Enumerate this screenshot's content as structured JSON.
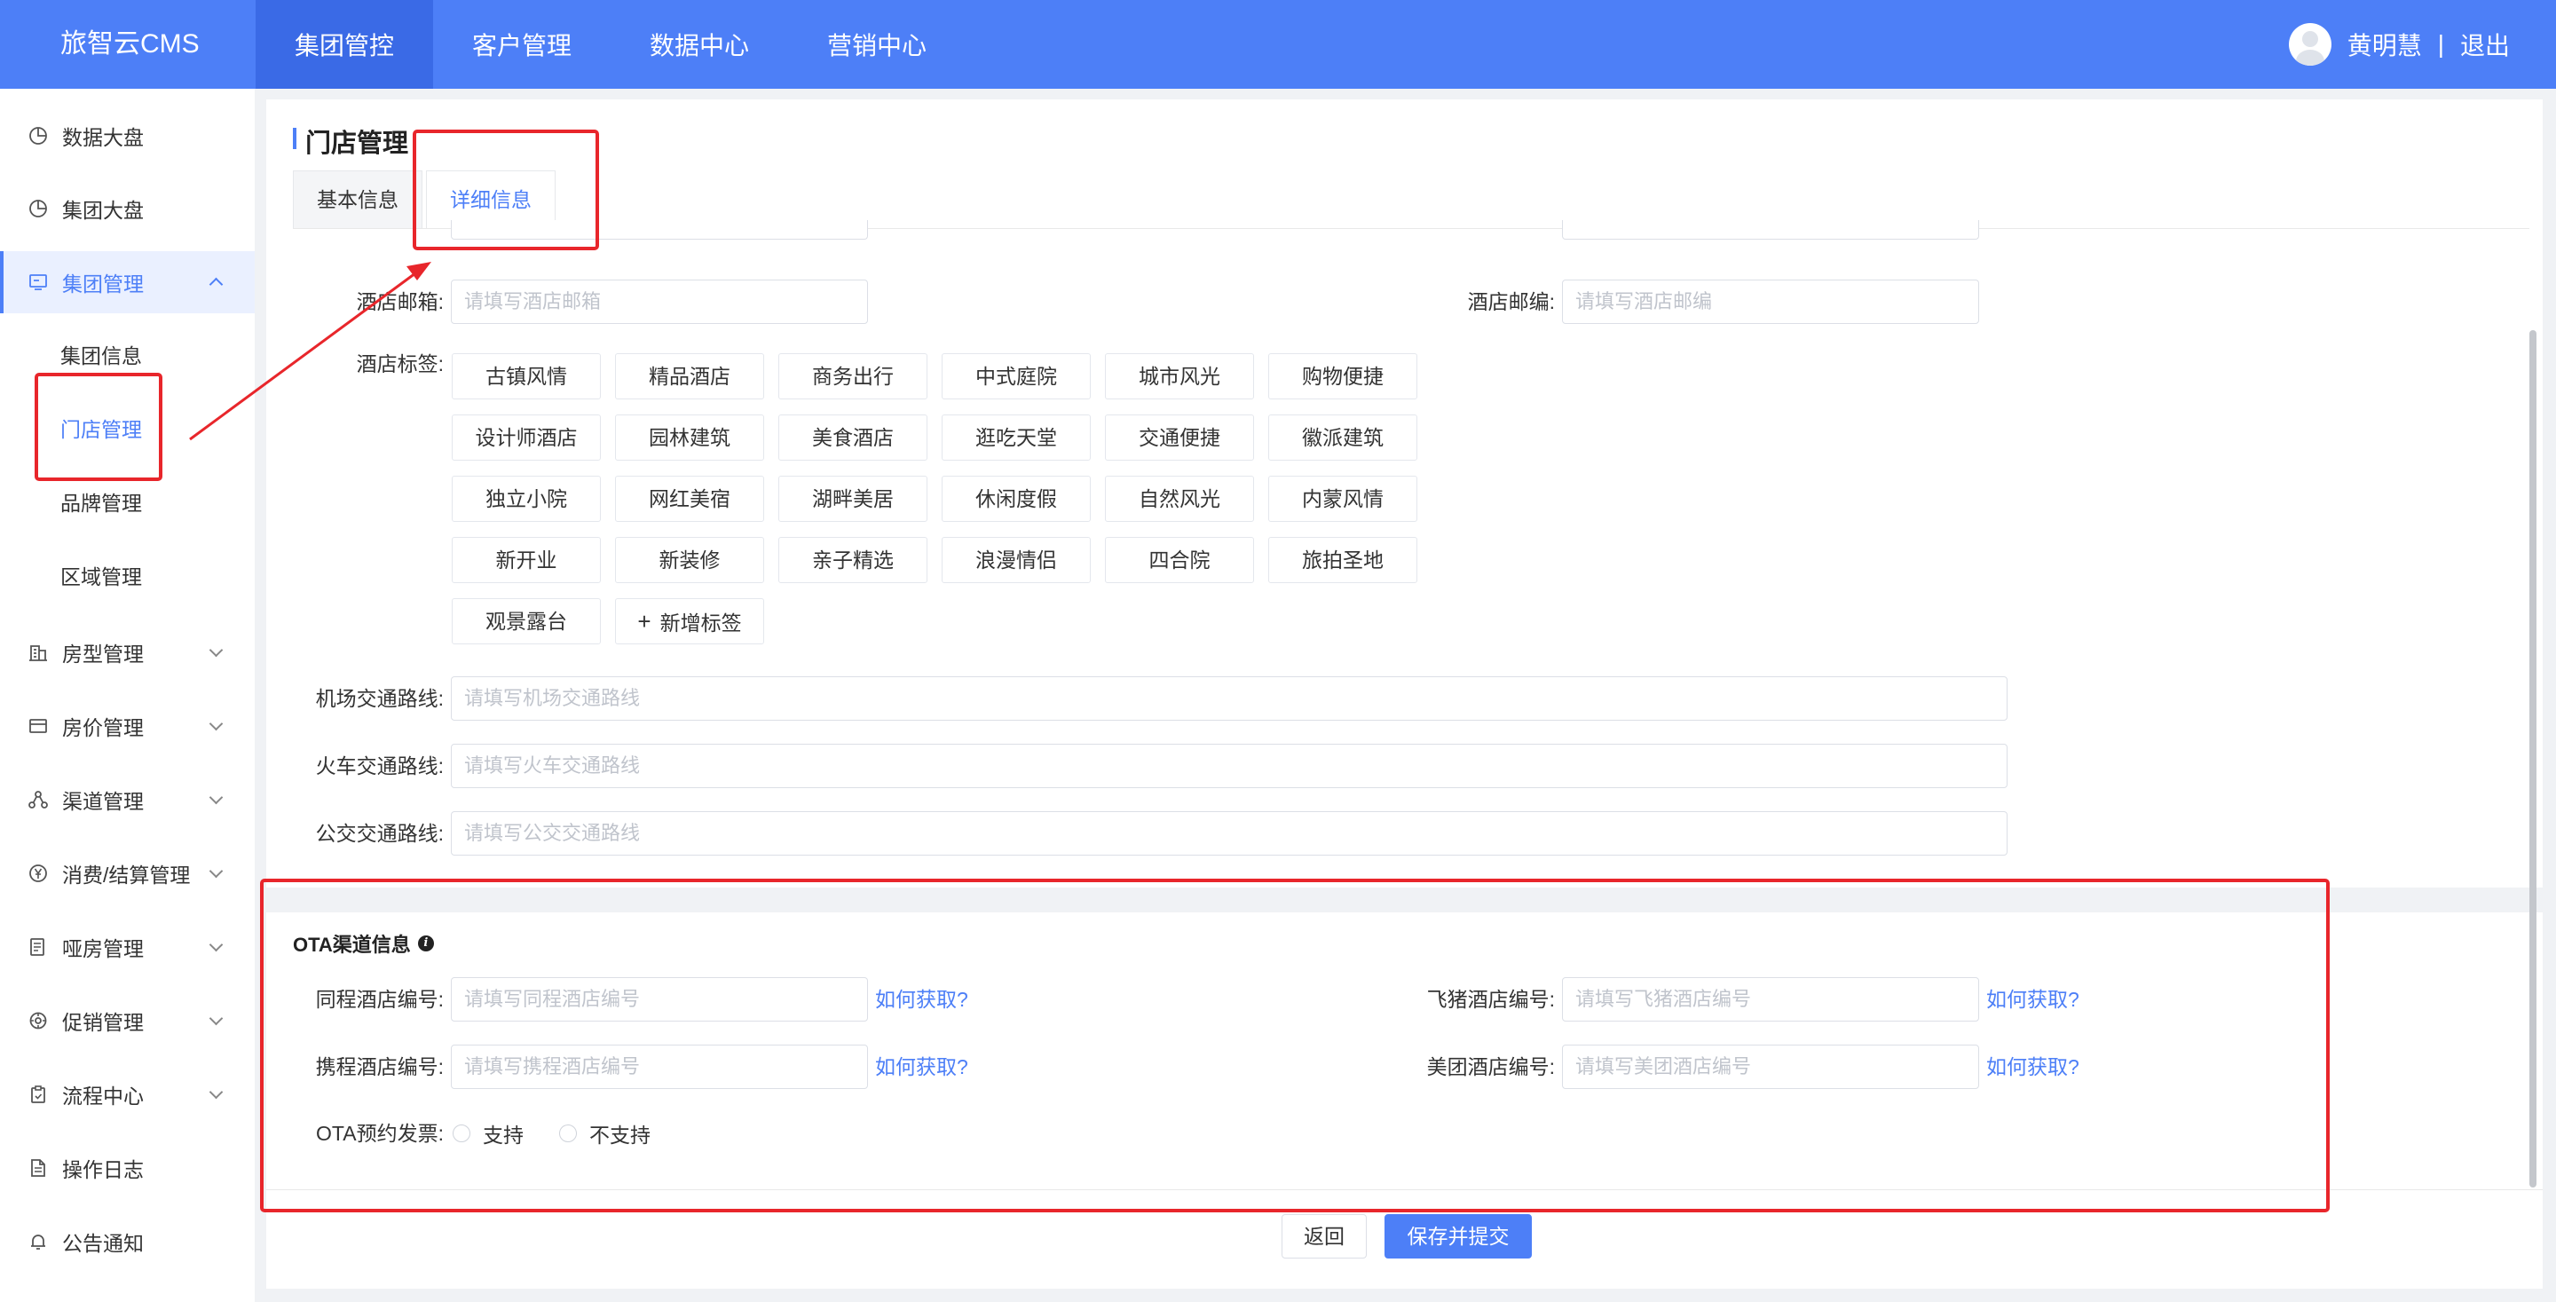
{
  "header": {
    "logo": "旅智云CMS",
    "nav": [
      "集团管控",
      "客户管理",
      "数据中心",
      "营销中心"
    ],
    "active_nav": 0,
    "user_name": "黄明慧",
    "separator": "|",
    "logout": "退出"
  },
  "sidebar": {
    "items": [
      {
        "label": "数据大盘",
        "icon": "pie-chart-icon"
      },
      {
        "label": "集团大盘",
        "icon": "pie-chart-icon"
      },
      {
        "label": "集团管理",
        "icon": "monitor-icon",
        "expanded": true
      },
      {
        "label": "房型管理",
        "icon": "building-icon"
      },
      {
        "label": "房价管理",
        "icon": "card-icon"
      },
      {
        "label": "渠道管理",
        "icon": "network-icon"
      },
      {
        "label": "消费/结算管理",
        "icon": "yen-icon"
      },
      {
        "label": "哑房管理",
        "icon": "list-icon"
      },
      {
        "label": "促销管理",
        "icon": "settings-icon"
      },
      {
        "label": "流程中心",
        "icon": "clipboard-icon"
      },
      {
        "label": "操作日志",
        "icon": "document-icon"
      },
      {
        "label": "公告通知",
        "icon": "bell-icon"
      }
    ],
    "sub_items": [
      "集团信息",
      "门店管理",
      "品牌管理",
      "区域管理"
    ],
    "active_sub": 1
  },
  "page": {
    "title": "门店管理",
    "tabs": [
      "基本信息",
      "详细信息"
    ],
    "active_tab": 1
  },
  "form": {
    "email_label": "酒店邮箱:",
    "email_placeholder": "请填写酒店邮箱",
    "zip_label": "酒店邮编:",
    "zip_placeholder": "请填写酒店邮编",
    "tags_label": "酒店标签:",
    "tags": [
      [
        "古镇风情",
        "精品酒店",
        "商务出行",
        "中式庭院",
        "城市风光",
        "购物便捷"
      ],
      [
        "设计师酒店",
        "园林建筑",
        "美食酒店",
        "逛吃天堂",
        "交通便捷",
        "徽派建筑"
      ],
      [
        "独立小院",
        "网红美宿",
        "湖畔美居",
        "休闲度假",
        "自然风光",
        "内蒙风情"
      ],
      [
        "新开业",
        "新装修",
        "亲子精选",
        "浪漫情侣",
        "四合院",
        "旅拍圣地"
      ],
      [
        "观景露台"
      ]
    ],
    "add_tag": "新增标签",
    "airport_label": "机场交通路线:",
    "airport_placeholder": "请填写机场交通路线",
    "train_label": "火车交通路线:",
    "train_placeholder": "请填写火车交通路线",
    "bus_label": "公交交通路线:",
    "bus_placeholder": "请填写公交交通路线"
  },
  "ota": {
    "title": "OTA渠道信息",
    "tongcheng_label": "同程酒店编号:",
    "tongcheng_placeholder": "请填写同程酒店编号",
    "feizhu_label": "飞猪酒店编号:",
    "feizhu_placeholder": "请填写飞猪酒店编号",
    "ctrip_label": "携程酒店编号:",
    "ctrip_placeholder": "请填写携程酒店编号",
    "meituan_label": "美团酒店编号:",
    "meituan_placeholder": "请填写美团酒店编号",
    "how_to_get": "如何获取?",
    "invoice_label": "OTA预约发票:",
    "invoice_options": [
      "支持",
      "不支持"
    ]
  },
  "footer": {
    "return_label": "返回",
    "save_label": "保存并提交"
  },
  "annotation_color": "#e8262b",
  "accent_color": "#4d7ff7"
}
